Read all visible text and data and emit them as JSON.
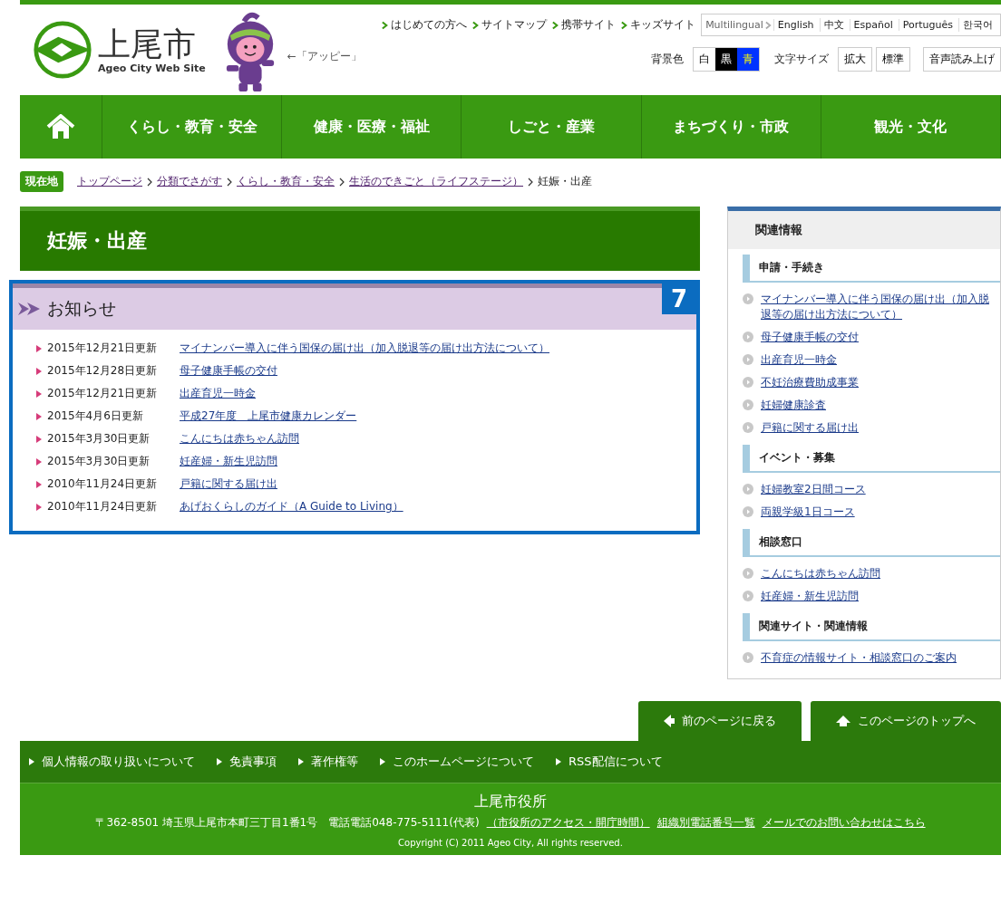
{
  "header": {
    "logo_text": "上尾市",
    "logo_subtitle": "Ageo City Web Site",
    "mascot_caption": "←「アッピー」",
    "top_links": [
      "はじめての方へ",
      "サイトマップ",
      "携帯サイト",
      "キッズサイト"
    ],
    "multilingual": {
      "label": "Multilingual",
      "languages": [
        "English",
        "中文",
        "Español",
        "Português",
        "한국어"
      ]
    },
    "background_color": {
      "label": "背景色",
      "options": [
        {
          "label": "白",
          "kind": "white"
        },
        {
          "label": "黒",
          "kind": "black"
        },
        {
          "label": "青",
          "kind": "blue"
        }
      ]
    },
    "text_size": {
      "label": "文字サイズ",
      "options": [
        "拡大",
        "標準"
      ]
    },
    "read_aloud": "音声読み上げ"
  },
  "nav": [
    "くらし・教育・安全",
    "健康・医療・福祉",
    "しごと・産業",
    "まちづくり・市政",
    "観光・文化"
  ],
  "breadcrumb": {
    "label": "現在地",
    "links": [
      "トップページ",
      "分類でさがす",
      "くらし・教育・安全",
      "生活のできごと（ライフステージ）"
    ],
    "current": "妊娠・出産"
  },
  "page_title": "妊娠・出産",
  "notices": {
    "title": "お知らせ",
    "badge": "7",
    "items": [
      {
        "date": "2015年12月21日更新",
        "title": "マイナンバー導入に伴う国保の届け出（加入脱退等の届け出方法について）"
      },
      {
        "date": "2015年12月28日更新",
        "title": "母子健康手帳の交付"
      },
      {
        "date": "2015年12月21日更新",
        "title": "出産育児一時金"
      },
      {
        "date": "2015年4月6日更新",
        "title": "平成27年度　上尾市健康カレンダー"
      },
      {
        "date": "2015年3月30日更新",
        "title": "こんにちは赤ちゃん訪問"
      },
      {
        "date": "2015年3月30日更新",
        "title": "妊産婦・新生児訪問"
      },
      {
        "date": "2010年11月24日更新",
        "title": "戸籍に関する届け出"
      },
      {
        "date": "2010年11月24日更新",
        "title": "あげおくらしのガイド（A Guide to Living）"
      }
    ]
  },
  "sidebar": {
    "title": "関連情報",
    "sections": [
      {
        "heading": "申請・手続き",
        "links": [
          "マイナンバー導入に伴う国保の届け出（加入脱退等の届け出方法について）",
          "母子健康手帳の交付",
          "出産育児一時金",
          "不妊治療費助成事業",
          "妊婦健康診査",
          "戸籍に関する届け出"
        ]
      },
      {
        "heading": "イベント・募集",
        "links": [
          "妊婦教室2日間コース",
          "両親学級1日コース"
        ]
      },
      {
        "heading": "相談窓口",
        "links": [
          "こんにちは赤ちゃん訪問",
          "妊産婦・新生児訪問"
        ]
      },
      {
        "heading": "関連サイト・関連情報",
        "links": [
          "不育症の情報サイト・相談窓口のご案内"
        ]
      }
    ]
  },
  "page_nav": {
    "back": "前のページに戻る",
    "top": "このページのトップへ"
  },
  "footer": {
    "links": [
      "個人情報の取り扱いについて",
      "免責事項",
      "著作権等",
      "このホームページについて",
      "RSS配信について"
    ],
    "office": "上尾市役所",
    "address": "〒362-8501 埼玉県上尾市本町三丁目1番1号　電話電話048-775-5111(代表)",
    "address_links": [
      "（市役所のアクセス・開庁時間）",
      "組織別電話番号一覧",
      "メールでのお問い合わせはこちら"
    ],
    "copyright": "Copyright (C) 2011 Ageo City, All rights reserved."
  }
}
